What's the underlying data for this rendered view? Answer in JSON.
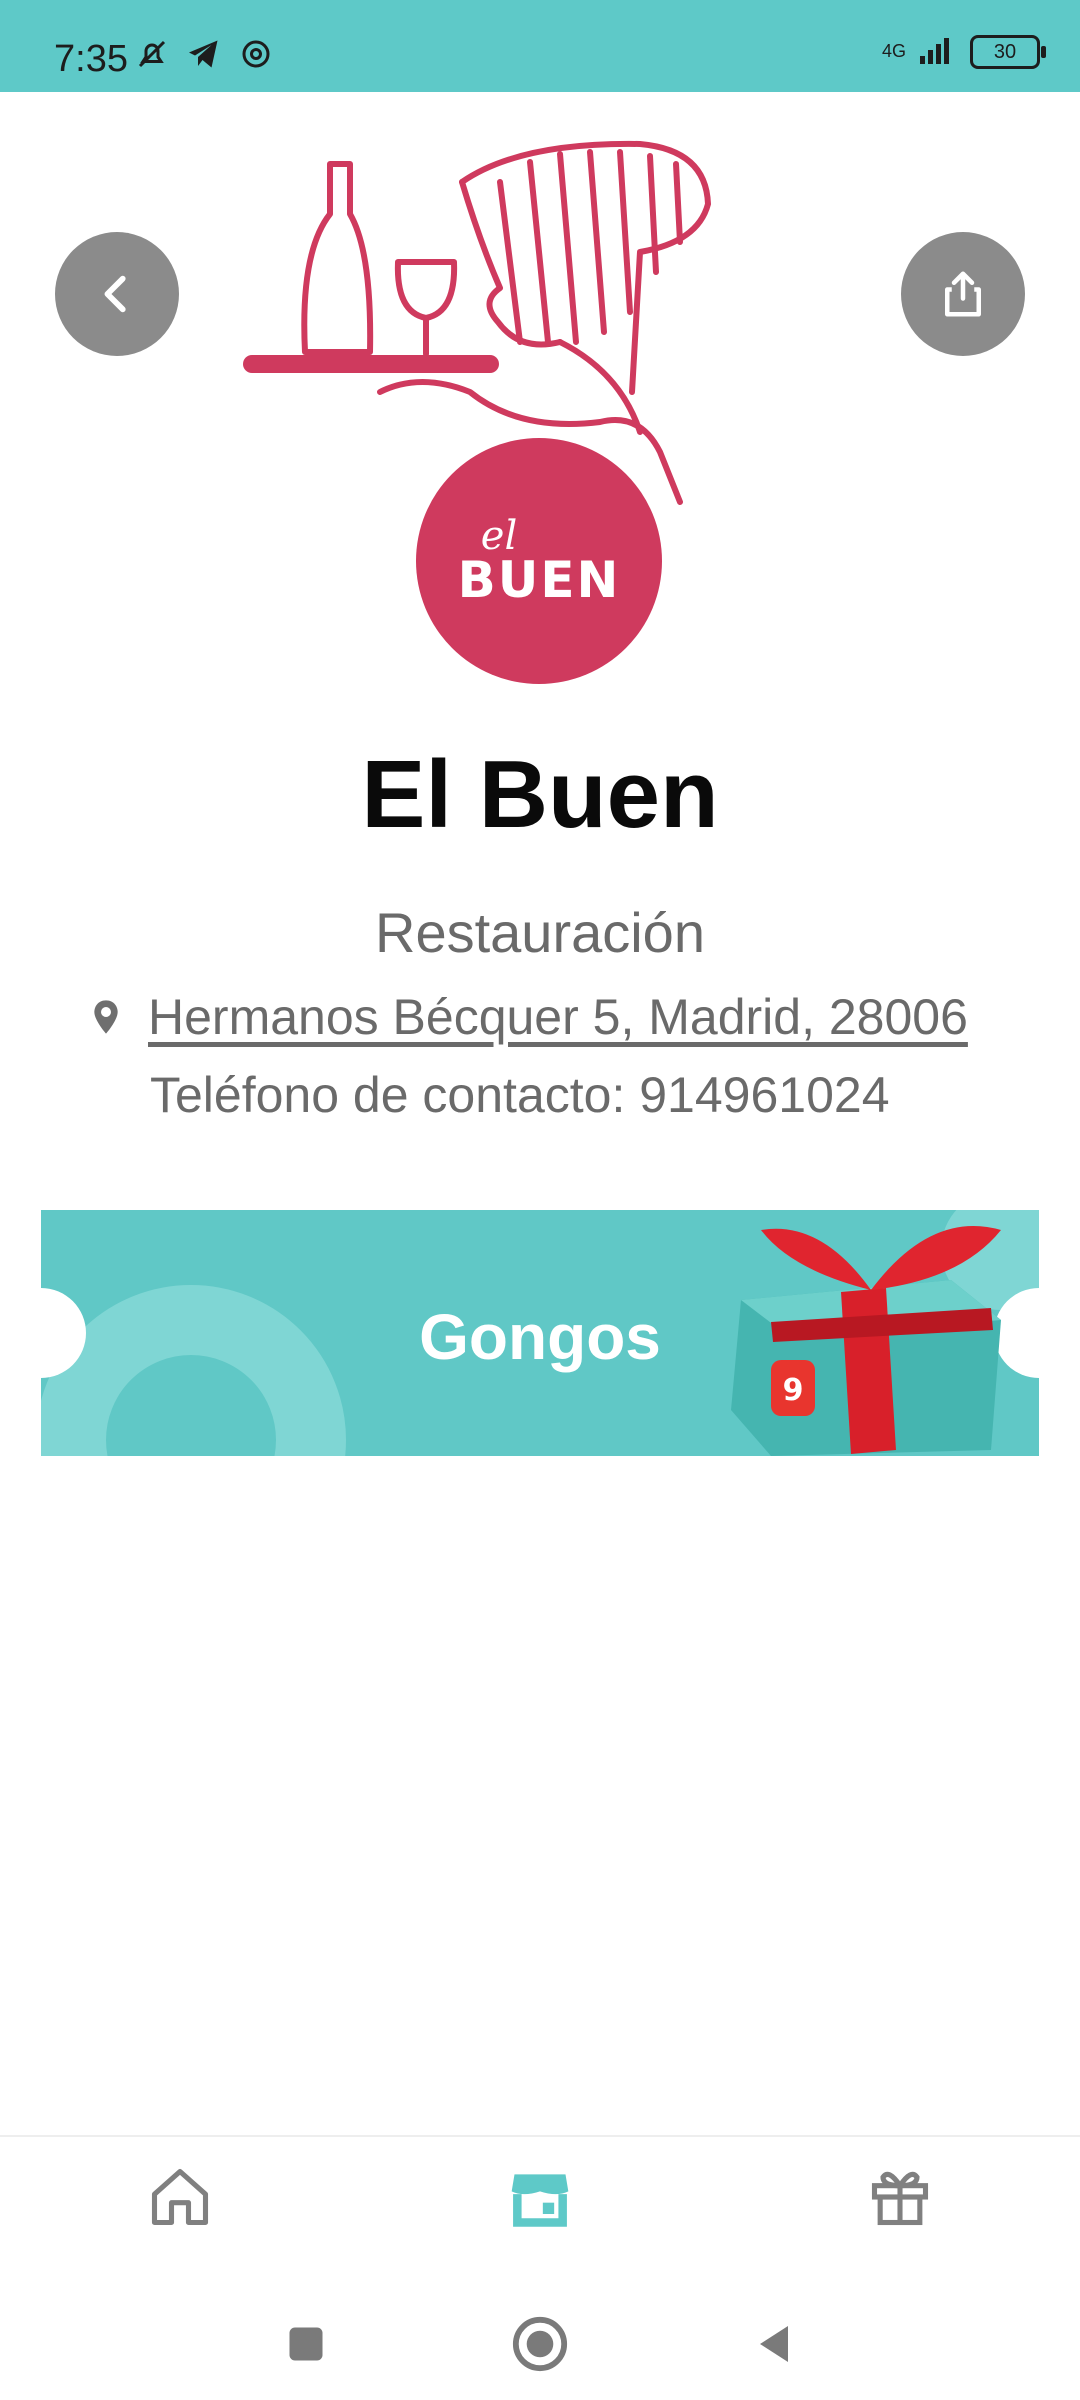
{
  "status_bar": {
    "time": "7:35",
    "network": "4G",
    "battery": "30"
  },
  "restaurant": {
    "logo_small": "el",
    "logo_big": "BUEN",
    "name": "El Buen",
    "category": "Restauración",
    "address": "Hermanos Bécquer 5, Madrid, 28006",
    "phone": "Teléfono de contacto: 914961024"
  },
  "coupon": {
    "label": "Gongos",
    "badge": "9"
  },
  "icons": {
    "back": "back-arrow-icon",
    "share": "share-icon",
    "location": "location-pin-icon",
    "home": "home-icon",
    "store": "store-icon",
    "gift": "gift-icon"
  },
  "colors": {
    "accent": "#5ec9c8",
    "brand": "#cf3a5e",
    "gift_ribbon": "#d8202a"
  }
}
